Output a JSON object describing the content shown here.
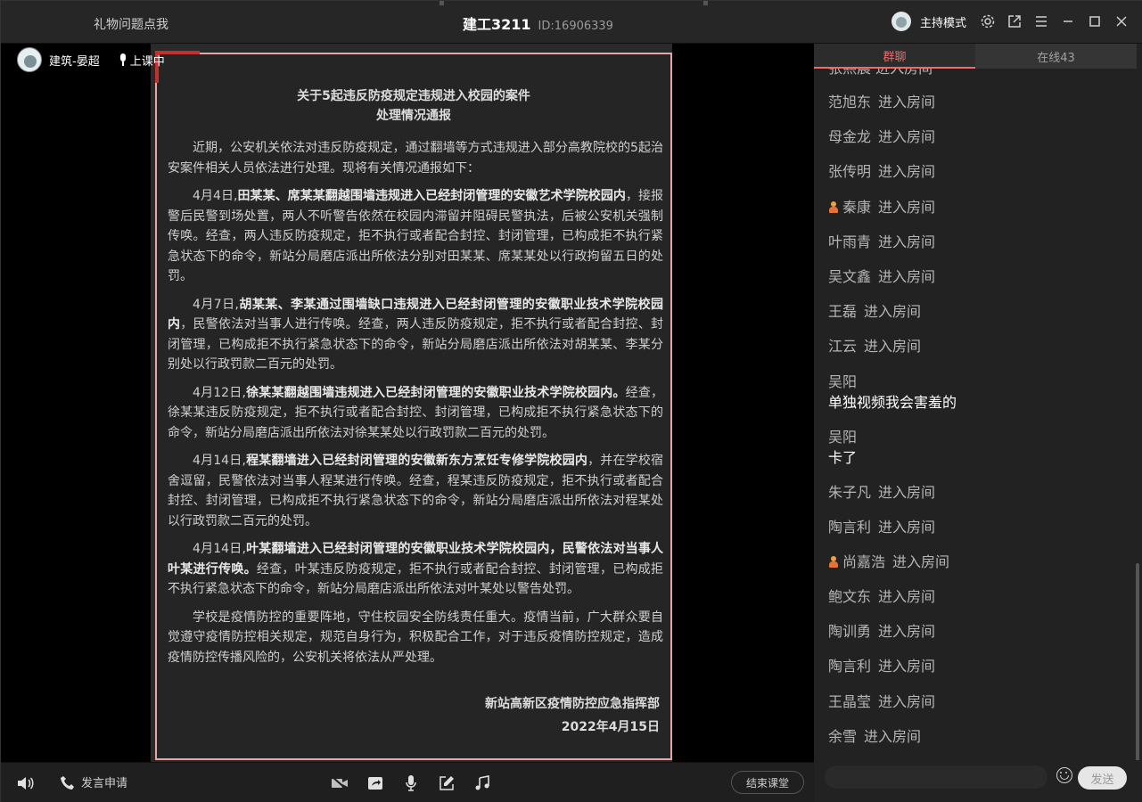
{
  "topbar": {
    "gift_issue_link": "礼物问题点我",
    "room_title": "建工3211",
    "room_id": "ID:16906339",
    "host_mode_label": "主持模式",
    "icons": [
      "settings-icon",
      "popout-icon",
      "menu-icon",
      "minimize-icon",
      "maximize-icon",
      "close-icon"
    ]
  },
  "stage": {
    "presenter_name": "建筑-晏超",
    "presenter_status": "上课中",
    "document": {
      "title_line1": "关于5起违反防疫规定违规进入校园的案件",
      "title_line2": "处理情况通报",
      "paragraphs": [
        {
          "plain": "近期，公安机关依法对违反防疫规定，通过翻墙等方式违规进入部分高教院校的5起治安案件相关人员依法进行处理。现将有关情况通报如下："
        },
        {
          "lead": "4月4日,",
          "bold": "田某某、席某某翻越围墙违规进入已经封闭管理的安徽艺术学院校园内",
          "rest": "，接报警后民警到场处置，两人不听警告依然在校园内滞留并阻碍民警执法，后被公安机关强制传唤。经查，两人违反防疫规定，拒不执行或者配合封控、封闭管理，已构成拒不执行紧急状态下的命令，新站分局磨店派出所依法分别对田某某、席某某处以行政拘留五日的处罚。"
        },
        {
          "lead": "4月7日,",
          "bold": "胡某某、李某通过围墙缺口违规进入已经封闭管理的安徽职业技术学院校园内",
          "rest": "，民警依法对当事人进行传唤。经查，两人违反防疫规定，拒不执行或者配合封控、封闭管理，已构成拒不执行紧急状态下的命令，新站分局磨店派出所依法对胡某某、李某分别处以行政罚款二百元的处罚。"
        },
        {
          "lead": "4月12日,",
          "bold": "徐某某翻越围墙违规进入已经封闭管理的安徽职业技术学院校园内。",
          "rest": "经查，徐某某违反防疫规定，拒不执行或者配合封控、封闭管理，已构成拒不执行紧急状态下的命令，新站分局磨店派出所依法对徐某某处以行政罚款二百元的处罚。"
        },
        {
          "lead": "4月14日,",
          "bold": "程某翻墙进入已经封闭管理的安徽新东方烹饪专修学院校园内",
          "rest": "，并在学校宿舍逗留，民警依法对当事人程某进行传唤。经查，程某违反防疫规定，拒不执行或者配合封控、封闭管理，已构成拒不执行紧急状态下的命令，新站分局磨店派出所依法对程某处以行政罚款二百元的处罚。"
        },
        {
          "lead": "4月14日,",
          "bold": "叶某翻墙进入已经封闭管理的安徽职业技术学院校园内，民警依法对当事人叶某进行传唤。",
          "rest": "经查，叶某违反防疫规定，拒不执行或者配合封控、封闭管理，已构成拒不执行紧急状态下的命令，新站分局磨店派出所依法对叶某处以警告处罚。"
        },
        {
          "plain": "学校是疫情防控的重要阵地，守住校园安全防线责任重大。疫情当前，广大群众要自觉遵守疫情防控相关规定，规范自身行为，积极配合工作，对于违反疫情防控规定，造成疫情防控传播风险的，公安机关将依法从严处理。"
        }
      ],
      "signature_org": "新站高新区疫情防控应急指挥部",
      "signature_date": "2022年4月15日"
    }
  },
  "bottombar": {
    "speak_request_label": "发言申请",
    "end_class_label": "结束课堂",
    "icons": [
      "speaker-icon",
      "phone-icon",
      "camera-off-icon",
      "screen-share-icon",
      "microphone-icon",
      "edit-icon",
      "music-icon"
    ]
  },
  "sidebar": {
    "tabs": [
      {
        "label": "群聊",
        "active": true
      },
      {
        "label": "在线43",
        "active": false
      }
    ],
    "partial_top_entry": "张熙晨 进入房间",
    "entries": [
      {
        "type": "join",
        "name": "范旭东",
        "action": "进入房间",
        "badge": false
      },
      {
        "type": "join",
        "name": "母金龙",
        "action": "进入房间",
        "badge": false
      },
      {
        "type": "join",
        "name": "张传明",
        "action": "进入房间",
        "badge": false
      },
      {
        "type": "join",
        "name": "秦康",
        "action": "进入房间",
        "badge": true
      },
      {
        "type": "join",
        "name": "叶雨青",
        "action": "进入房间",
        "badge": false
      },
      {
        "type": "join",
        "name": "吴文鑫",
        "action": "进入房间",
        "badge": false
      },
      {
        "type": "join",
        "name": "王磊",
        "action": "进入房间",
        "badge": false
      },
      {
        "type": "join",
        "name": "江云",
        "action": "进入房间",
        "badge": false
      },
      {
        "type": "message",
        "name": "吴阳",
        "text": "单独视频我会害羞的"
      },
      {
        "type": "message",
        "name": "吴阳",
        "text": "卡了"
      },
      {
        "type": "join",
        "name": "朱子凡",
        "action": "进入房间",
        "badge": false
      },
      {
        "type": "join",
        "name": "陶言利",
        "action": "进入房间",
        "badge": false
      },
      {
        "type": "join",
        "name": "尚嘉浩",
        "action": "进入房间",
        "badge": true
      },
      {
        "type": "join",
        "name": "鲍文东",
        "action": "进入房间",
        "badge": false
      },
      {
        "type": "join",
        "name": "陶训勇",
        "action": "进入房间",
        "badge": false
      },
      {
        "type": "join",
        "name": "陶言利",
        "action": "进入房间",
        "badge": false
      },
      {
        "type": "join",
        "name": "王晶莹",
        "action": "进入房间",
        "badge": false
      },
      {
        "type": "join",
        "name": "余雪",
        "action": "进入房间",
        "badge": false
      }
    ],
    "input_value": "",
    "send_label": "发送"
  },
  "colors": {
    "accent": "#f06a6a",
    "doc_border": "#e7a6a6",
    "badge": "#e2733a"
  }
}
